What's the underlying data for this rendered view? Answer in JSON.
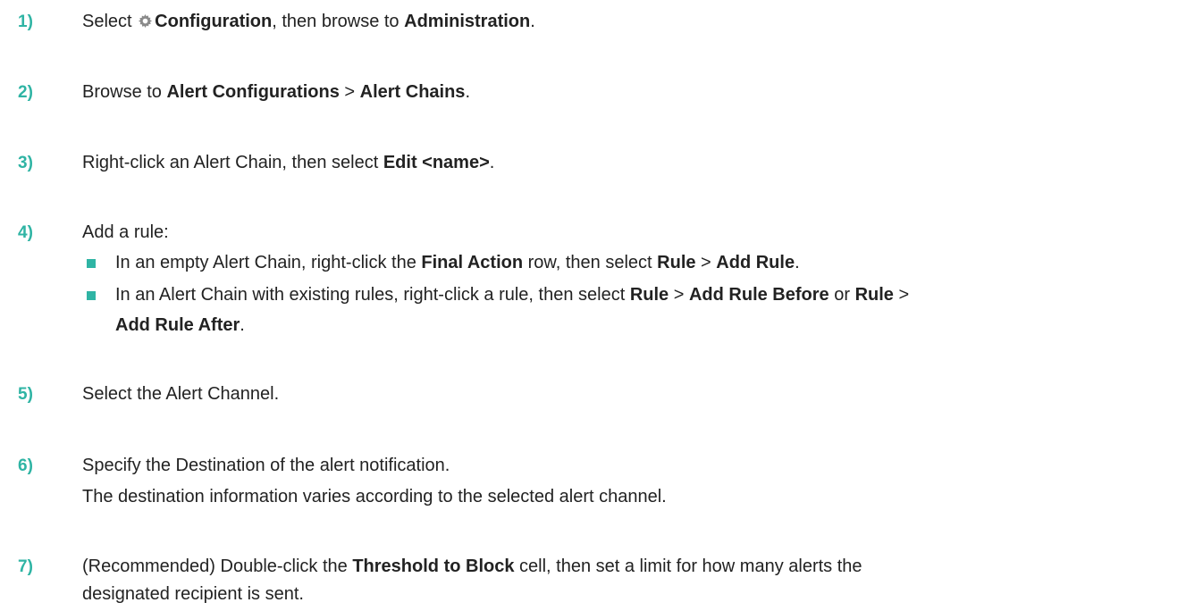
{
  "accent_color": "#2fb4a4",
  "steps": [
    {
      "number": "1)",
      "t1": "Select ",
      "icon": "gear-icon",
      "b1": "Configuration",
      "t2": ", then browse to ",
      "b2": "Administration",
      "t3": "."
    },
    {
      "number": "2)",
      "t1": "Browse to ",
      "b1": "Alert Configurations",
      "t2": " > ",
      "b2": "Alert Chains",
      "t3": "."
    },
    {
      "number": "3)",
      "t1": "Right-click an Alert Chain, then select ",
      "b1": "Edit <name>",
      "t2": "."
    },
    {
      "number": "4)",
      "t1": "Add a rule:",
      "bullets": [
        {
          "t1": "In an empty Alert Chain, right-click the ",
          "b1": "Final Action",
          "t2": " row, then select ",
          "b2": "Rule",
          "t3": " > ",
          "b3": "Add Rule",
          "t4": "."
        },
        {
          "t1": "In an Alert Chain with existing rules, right-click a rule, then select ",
          "b1": "Rule",
          "t2": " > ",
          "b2": "Add Rule Before",
          "t3": " or ",
          "b3": "Rule",
          "t4": " >",
          "b4": "Add Rule After",
          "t5": "."
        }
      ]
    },
    {
      "number": "5)",
      "t1": "Select the Alert Channel."
    },
    {
      "number": "6)",
      "t1": "Specify the Destination of the alert notification.",
      "t2": "The destination information varies according to the selected alert channel."
    },
    {
      "number": "7)",
      "t1": "(Recommended) Double-click the ",
      "b1": "Threshold to Block",
      "t2": " cell, then set a limit for how many alerts the",
      "t3": "designated recipient is sent."
    }
  ]
}
